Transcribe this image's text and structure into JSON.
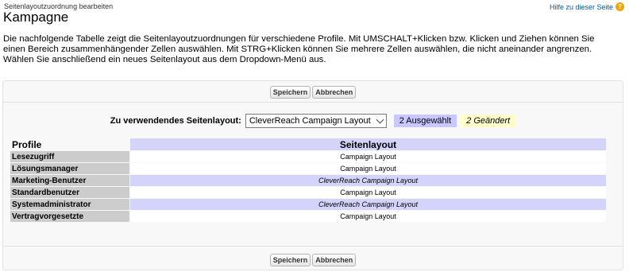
{
  "header": {
    "subtitle": "Seitenlayoutzuordnung bearbeiten",
    "title": "Kampagne",
    "help_link": "Hilfe zu dieser Seite",
    "help_icon": "?"
  },
  "description": "Die nachfolgende Tabelle zeigt die Seitenlayoutzuordnungen für verschiedene Profile. Mit UMSCHALT+Klicken bzw. Klicken und Ziehen können Sie einen Bereich zusammenhängender Zellen auswählen. Mit STRG+Klicken können Sie mehrere Zellen auswählen, die nicht aneinander angrenzen. Wählen Sie anschließend ein neues Seitenlayout aus dem Dropdown-Menü aus.",
  "buttons": {
    "save": "Speichern",
    "cancel": "Abbrechen"
  },
  "layout_picker": {
    "label": "Zu verwendendes Seitenlayout:",
    "selected": "CleverReach Campaign Layout",
    "selected_count": "2 Ausgewählt",
    "changed_count": "2 Geändert"
  },
  "table": {
    "col_profile": "Profile",
    "col_layout": "Seitenlayout",
    "rows": [
      {
        "profile": "Lesezugriff",
        "layout": "Campaign Layout"
      },
      {
        "profile": "Lösungsmanager",
        "layout": "Campaign Layout"
      },
      {
        "profile": "Marketing-Benutzer",
        "layout": "CleverReach Campaign Layout"
      },
      {
        "profile": "Standardbenutzer",
        "layout": "Campaign Layout"
      },
      {
        "profile": "Systemadministrator",
        "layout": "CleverReach Campaign Layout"
      },
      {
        "profile": "Vertragvorgesetzte",
        "layout": "Campaign Layout"
      }
    ]
  }
}
